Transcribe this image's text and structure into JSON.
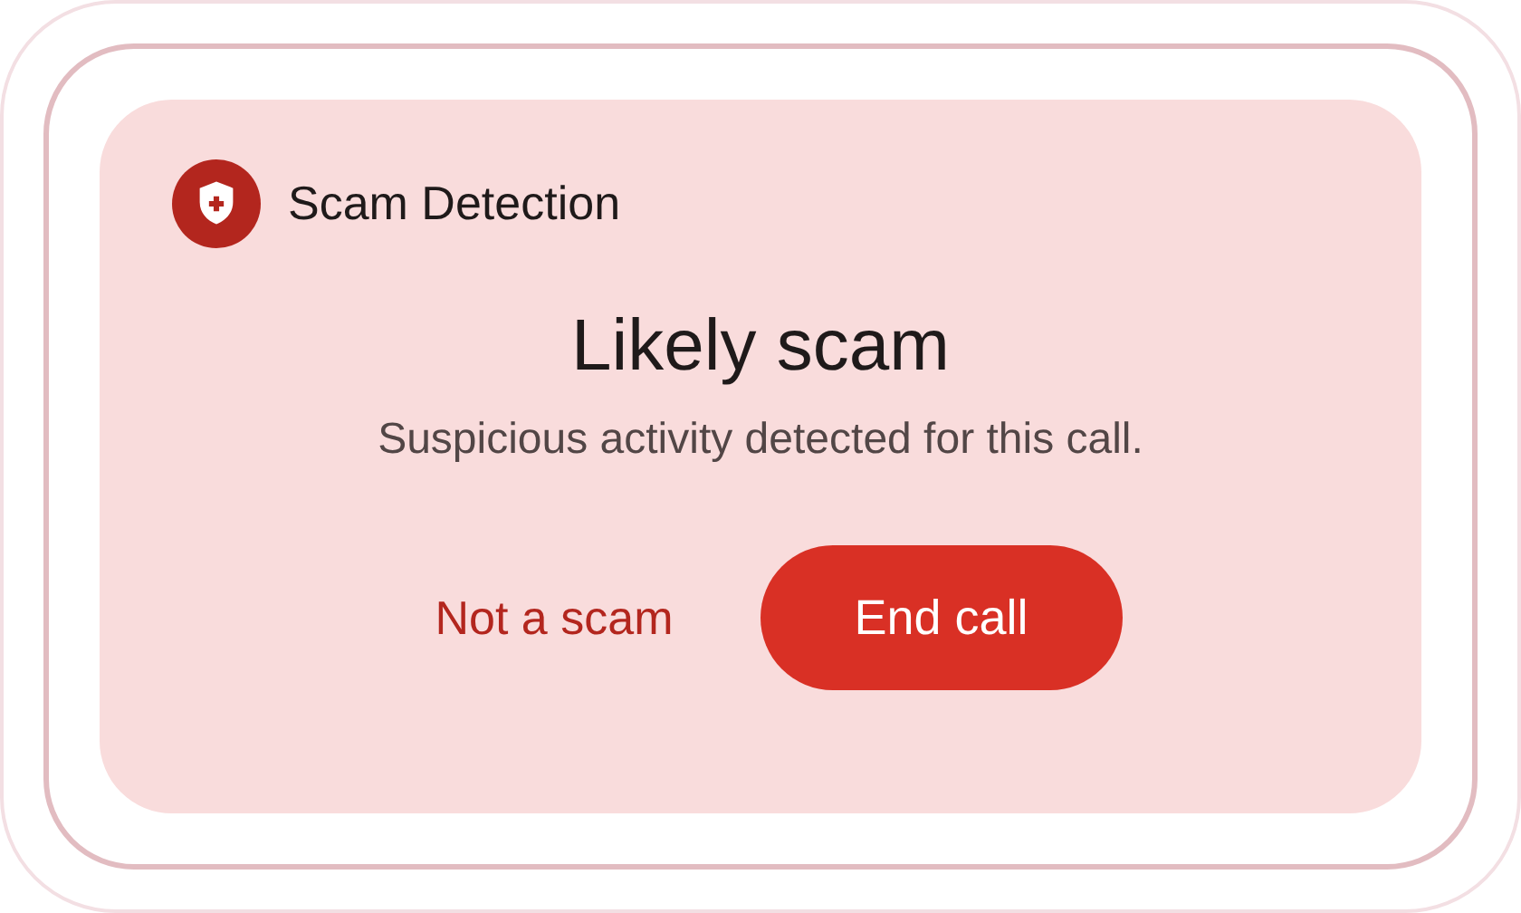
{
  "header": {
    "title": "Scam Detection"
  },
  "headline": "Likely scam",
  "message": "Suspicious activity detected for this call.",
  "actions": [
    {
      "label": "Not a scam",
      "kind": "text"
    },
    {
      "label": "End call",
      "kind": "filled"
    }
  ]
}
